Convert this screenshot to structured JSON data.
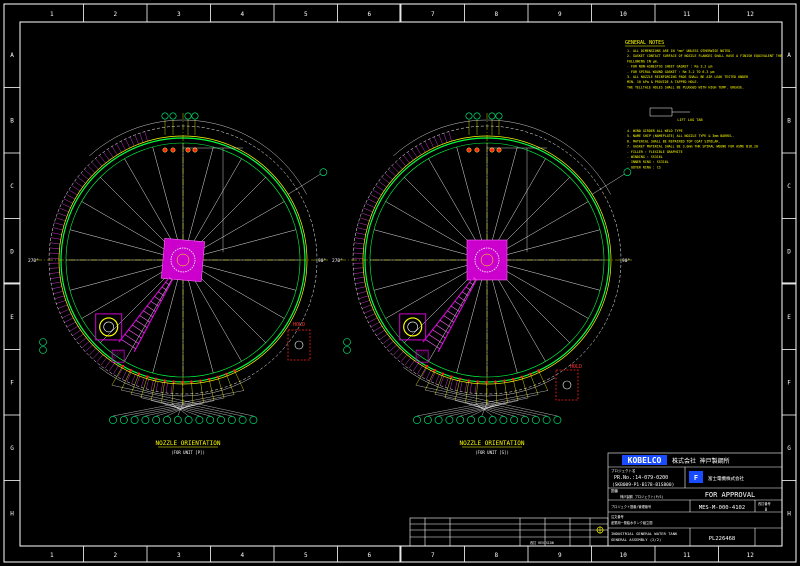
{
  "grid": {
    "columns": [
      "1",
      "2",
      "3",
      "4",
      "5",
      "6",
      "7",
      "8",
      "9",
      "10",
      "11",
      "12"
    ],
    "rows": [
      "A",
      "B",
      "C",
      "D",
      "E",
      "F",
      "G",
      "H"
    ]
  },
  "views": [
    {
      "title": "NOZZLE ORIENTATION",
      "subtitle": "(FOR UNIT [P])",
      "angle_left": "270°",
      "angle_right": "90°",
      "hold": "HOLD"
    },
    {
      "title": "NOZZLE ORIENTATION",
      "subtitle": "(FOR UNIT [S])",
      "angle_left": "270°",
      "angle_right": "90°",
      "hold": "HOLD"
    }
  ],
  "notes": {
    "heading": "GENERAL NOTES",
    "lines": [
      "1. ALL DIMENSIONS ARE IN \"mm\" UNLESS OTHERWISE NOTED.",
      "2. GASKET CONTACT SURFACE OF NOZZLE FLANGES SHALL HAVE A FINISH EQUIVALENT THE",
      "   FOLLOWING IN μm.",
      "   - FOR NON-ASBESTOS SHEET GASKET      : Ra 3.2 μm",
      "   - FOR SPIRAL WOUND GASKET            : Ra 3.2 TO 6.3 μm",
      "3. ALL NOZZLE REINFORCING PADS SHALL BE AIR LEAK TESTED UNDER",
      "   MIN. 10 kPa & PROVIDE A TAPPED HOLE.",
      "   THE TELLTALE HOLES SHALL BE PLUGGED WITH HIGH TEMP. GREASE.",
      "4. WIND GIRDER ALL WELD TYPE",
      "5. NAME SHIP (NAMEPLATE) ALL NOZZLE TYPE & 3mm BARREL.",
      "6. MATERIAL SHALL BE REPAIRED TOP COAT SIMILAR.",
      "7. GASKET MATERIAL SHALL BE 3.0mm THK SPIRAL WOUND FOR ASME B16.20",
      "   - FILLER           : FLEXIBLE GRAPHITE",
      "   - WINDING          : SS316L",
      "   - INNER RING       : SS316L",
      "   - OUTER RING       : CS"
    ]
  },
  "title_block": {
    "company": "KOBELCO",
    "company_jp": "株式会社 神戸製鋼所",
    "project_label": "プロジェクト名",
    "pr_number": "PR.No.:14-079-0200",
    "pr_sub": "(SKB009-P1-B178-B1S800)",
    "order_label": "注文番号",
    "order_value": "神戸製鋼 プロジェクト(P/S)",
    "client_jp": "富士電機株式会社",
    "drawing_label": "図番",
    "status": "FOR APPROVAL",
    "doc_label": "プロジェクト図番/管理番号",
    "doc_number": "MES-M-000-4102",
    "rev_label": "改訂番号",
    "rev": "0",
    "desc_jp": "産業用一般給水タンク組立図",
    "desc_en_1": "INDUSTRIAL GENERAL WATER TANK",
    "desc_en_2": "GENERAL ASSEMBLY (2/2)",
    "sheet": "PL226468",
    "revision_table_label": "改訂 REVISION"
  }
}
